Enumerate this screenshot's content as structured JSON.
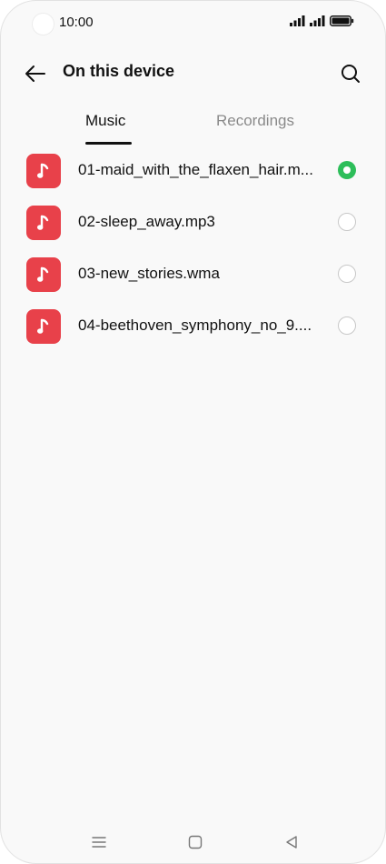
{
  "status_bar": {
    "time": "10:00"
  },
  "header": {
    "title": "On this device",
    "back_icon": "arrow-left-icon",
    "search_icon": "search-icon"
  },
  "tabs": [
    {
      "label": "Music",
      "selected": true
    },
    {
      "label": "Recordings",
      "selected": false
    }
  ],
  "files": [
    {
      "name": "01-maid_with_the_flaxen_hair.m...",
      "selected": true
    },
    {
      "name": "02-sleep_away.mp3",
      "selected": false
    },
    {
      "name": "03-new_stories.wma",
      "selected": false
    },
    {
      "name": "04-beethoven_symphony_no_9....",
      "selected": false
    }
  ],
  "colors": {
    "music_icon_bg": "#e8414a",
    "radio_selected": "#2dbe5a",
    "background": "#f9f9f9"
  },
  "nav_bar": {
    "menu_icon": "menu-icon",
    "home_icon": "home-square-icon",
    "back_icon": "back-triangle-icon"
  }
}
